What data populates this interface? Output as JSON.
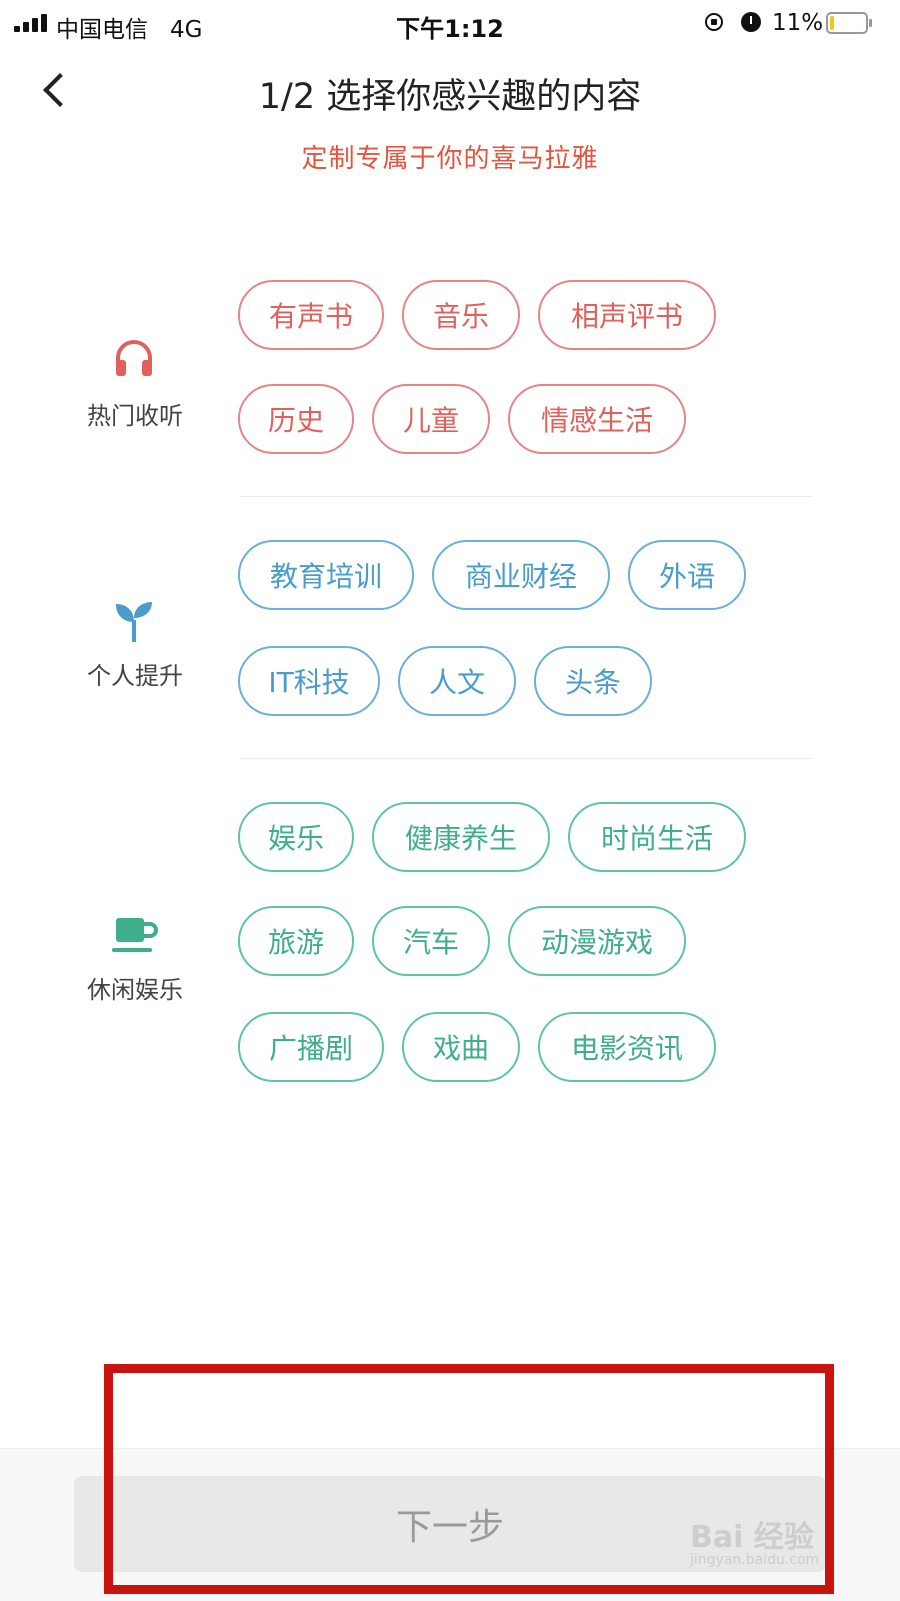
{
  "status_bar": {
    "carrier": "中国电信",
    "network": "4G",
    "time": "下午1:12",
    "battery": "11%",
    "battery_level": 0.11,
    "icons": [
      "signal-icon",
      "rotation-lock-icon",
      "alarm-icon",
      "battery-icon"
    ]
  },
  "header": {
    "title": "1/2 选择你感兴趣的内容",
    "subtitle": "定制专属于你的喜马拉雅"
  },
  "colors": {
    "hot": "#e0615c",
    "improve": "#4a9ccc",
    "leisure": "#3fae8a",
    "subtitle": "#e4553f",
    "highlight": "#c9130f"
  },
  "categories": [
    {
      "label": "热门收听",
      "icon": "headphones-icon",
      "tags": [
        "有声书",
        "音乐",
        "相声评书",
        "历史",
        "儿童",
        "情感生活"
      ]
    },
    {
      "label": "个人提升",
      "icon": "sprout-icon",
      "tags": [
        "教育培训",
        "商业财经",
        "外语",
        "IT科技",
        "人文",
        "头条"
      ]
    },
    {
      "label": "休闲娱乐",
      "icon": "coffee-cup-icon",
      "tags": [
        "娱乐",
        "健康养生",
        "时尚生活",
        "旅游",
        "汽车",
        "动漫游戏",
        "广播剧",
        "戏曲",
        "电影资讯"
      ]
    }
  ],
  "footer": {
    "next_label": "下一步"
  },
  "watermark": {
    "text": "Bai 经验",
    "sub": "jingyan.baidu.com"
  }
}
